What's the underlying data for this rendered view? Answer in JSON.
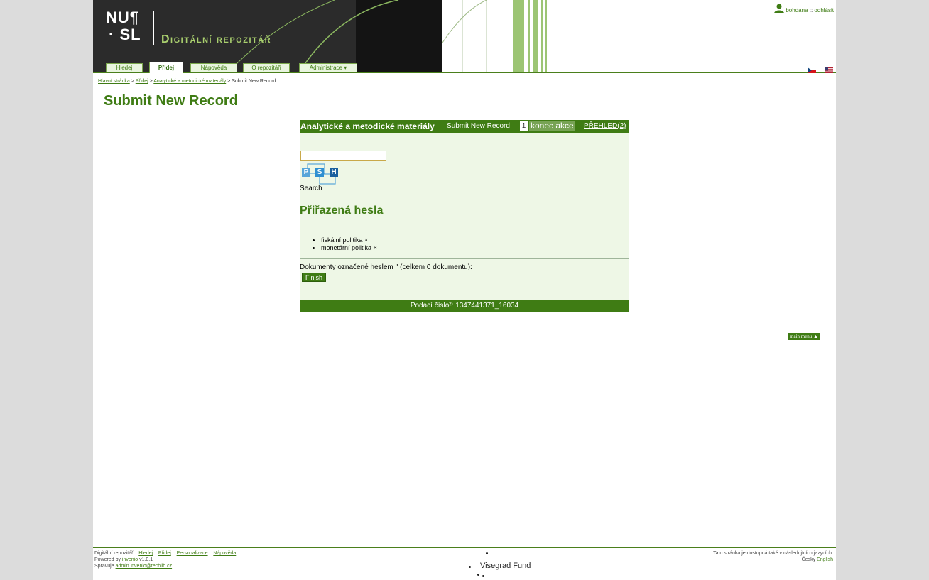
{
  "header": {
    "logo_top": "NU¶",
    "logo_bottom": "· SL",
    "site_title": "Digitální repozitář",
    "user": "bohdana",
    "separator": "::",
    "logout": "odhlásit",
    "tabs": [
      {
        "label": "Hledej"
      },
      {
        "label": "Přidej"
      },
      {
        "label": "Nápověda"
      },
      {
        "label": "O repozitáři"
      },
      {
        "label": "Administrace ▾"
      }
    ],
    "languages": [
      "cs-flag-icon",
      "en-flag-icon"
    ]
  },
  "breadcrumb": {
    "items": [
      "Hlavní stránka",
      "Přidej",
      "Analytické a metodické materiály"
    ],
    "current": "Submit New Record",
    "separator": ">"
  },
  "page_title": "Submit New Record",
  "panel": {
    "doctype": "Analytické a metodické materiály",
    "action": "Submit New Record",
    "step": "1",
    "end_action": "konec akce",
    "overview": "PŘEHLED(2)",
    "search_value": "",
    "psh_letters": [
      "P",
      "S",
      "H"
    ],
    "search_label": "Search",
    "assigned_title": "Přiřazená hesla",
    "keywords": [
      {
        "label": "fiskální politika",
        "remove": "×"
      },
      {
        "label": "monetární politika",
        "remove": "×"
      }
    ],
    "documents_label": "Dokumenty označené heslem '' (celkem 0 dokumentu):",
    "finish_label": "Finish",
    "submission_label": "Podací číslo²: 1347441371_16034"
  },
  "main_menu_label": "main menu ▲",
  "footer": {
    "line1_prefix": "Digitální repozitář ::",
    "links": [
      "Hledej",
      "Přidej",
      "Personalizace",
      "Nápověda"
    ],
    "powered_prefix": "Powered by",
    "powered_link": "invenio",
    "version": "v1.0.1",
    "managed_prefix": "Spravuje",
    "admin_email": "admin.invenio@techlib.cz",
    "visegrad": "Visegrad Fund",
    "lang_note": "Tato stránka je dostupná také v následujících jazycích:",
    "lang_cs": "Česky",
    "lang_en": "English"
  },
  "colors": {
    "accent": "#3f7c14",
    "panel_bg": "#eef7e6",
    "banner_dark": "#2b2b2b"
  }
}
